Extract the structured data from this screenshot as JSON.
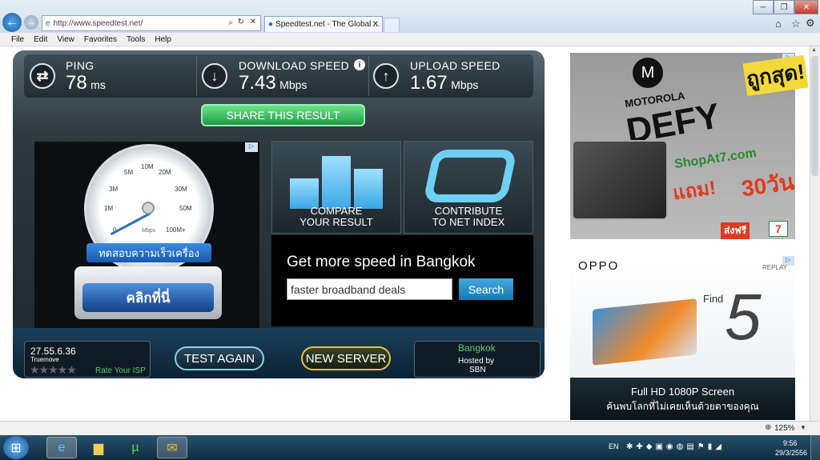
{
  "browser": {
    "address_url": "http://www.speedtest.net/",
    "tab_title": "Speedtest.net - The Global ...",
    "menu": [
      "File",
      "Edit",
      "View",
      "Favorites",
      "Tools",
      "Help"
    ],
    "zoom_level": "125%"
  },
  "speedtest": {
    "ping": {
      "label": "PING",
      "value": "78",
      "unit": "ms"
    },
    "download": {
      "label": "DOWNLOAD SPEED",
      "value": "7.43",
      "unit": "Mbps"
    },
    "upload": {
      "label": "UPLOAD SPEED",
      "value": "1.67",
      "unit": "Mbps"
    },
    "share_label": "SHARE THIS RESULT",
    "compare_label_1": "COMPARE",
    "compare_label_2": "YOUR RESULT",
    "contribute_label_1": "CONTRIBUTE",
    "contribute_label_2": "TO NET INDEX",
    "promo_title": "Get more speed in Bangkok",
    "search_value": "faster broadband deals",
    "search_button": "Search",
    "ip": "27.55.6.36",
    "isp": "Truemove",
    "rate_isp": "Rate Your ISP",
    "test_again": "TEST AGAIN",
    "new_server": "NEW SERVER",
    "server_city": "Bangkok",
    "hosted_by": "Hosted by",
    "host": "SBN"
  },
  "left_ad": {
    "speed_labels": [
      "5M",
      "10M",
      "20M",
      "3M",
      "30M",
      "1M",
      "50M",
      "0",
      "100M+"
    ],
    "gauge_unit": "Mbps",
    "badge_text": "ทดสอบความเร็วเครื่อง",
    "button_text": "คลิกที่นี่"
  },
  "right_ad_1": {
    "brand": "MOTOROLA",
    "product": "DEFY",
    "site": "ShopAt7.com",
    "thai_top": "ถูกสุด!",
    "thai_bottom": "ส่งฟรี",
    "promo_thai": "แถม!",
    "days": "30วัน"
  },
  "right_ad_2": {
    "brand": "OPPO",
    "replay": "REPLAY",
    "find": "Find",
    "model": "5",
    "line1": "Full HD 1080P Screen",
    "line2": "ค้นพบโลกที่ไม่เคยเห็นด้วยตาของคุณ"
  },
  "taskbar": {
    "lang": "EN",
    "time": "9:56",
    "date": "29/3/2556"
  },
  "colors": {
    "accent_green": "#2fae5b",
    "panel_dark": "#1f272d",
    "search_blue": "#1e8fc9",
    "gold": "#e2c44a"
  }
}
